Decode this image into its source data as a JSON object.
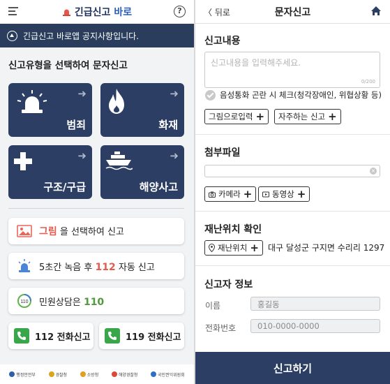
{
  "left": {
    "brand": {
      "part1": "긴급신고",
      "part2": "바로"
    },
    "help_icon": "?",
    "notice": "긴급신고 바로앱 공지사항입니다.",
    "section_title": "신고유형을 선택하여 문자신고",
    "tiles": [
      {
        "label": "범죄",
        "icon": "siren-icon"
      },
      {
        "label": "화재",
        "icon": "flame-icon"
      },
      {
        "label": "구조/구급",
        "icon": "cross-icon"
      },
      {
        "label": "해양사고",
        "icon": "ship-icon"
      }
    ],
    "tile_color": "#2c3e63",
    "photo_card": {
      "highlight": "그림",
      "text": "을 선택하여 신고"
    },
    "record_card": {
      "pre": "5초간 녹음 후",
      "num": "112",
      "post": "자동 신고"
    },
    "civil_card": {
      "text": "민원상담은",
      "num": "110",
      "icon_text": "110"
    },
    "call_buttons": [
      {
        "label": "112 전화신고"
      },
      {
        "label": "119 전화신고"
      }
    ],
    "footer_orgs": [
      "행정안전부",
      "경찰청",
      "소방청",
      "해양경찰청",
      "국민권익위원회"
    ]
  },
  "right": {
    "back_label": "뒤로",
    "title": "문자신고",
    "report_section": {
      "title": "신고내용",
      "placeholder": "신고내용을 입력해주세요.",
      "counter": "0/200",
      "check_label": "음성통화 곤란 시 체크(청각장애인, 위협상황 등)",
      "buttons": [
        "그림으로입력",
        "자주하는 신고"
      ]
    },
    "attach_section": {
      "title": "첨부파일",
      "buttons": [
        "카메라",
        "동영상"
      ]
    },
    "location_section": {
      "title": "재난위치 확인",
      "button": "재난위치",
      "address": "대구 달성군 구지면 수리리 1297"
    },
    "reporter_section": {
      "title": "신고자 정보",
      "name_label": "이름",
      "name_value": "홍길동",
      "phone_label": "전화번호",
      "phone_value": "010-0000-0000"
    },
    "submit_label": "신고하기",
    "accent_color": "#2c3e63"
  }
}
